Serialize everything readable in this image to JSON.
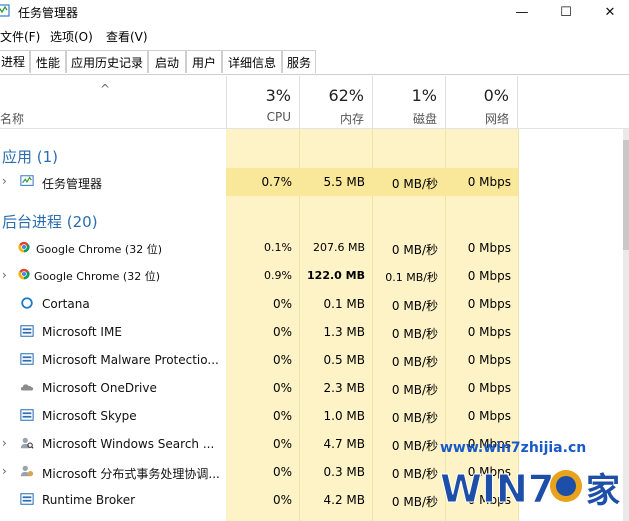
{
  "window": {
    "title": "任务管理器",
    "controls": {
      "minimize": "—",
      "maximize": "☐",
      "close": "✕"
    }
  },
  "menu": [
    "文件(F)",
    "选项(O)",
    "查看(V)"
  ],
  "tabs": [
    "进程",
    "性能",
    "应用历史记录",
    "启动",
    "用户",
    "详细信息",
    "服务"
  ],
  "header": {
    "name_label": "名称",
    "columns": [
      {
        "pct": "3%",
        "label": "CPU"
      },
      {
        "pct": "62%",
        "label": "内存"
      },
      {
        "pct": "1%",
        "label": "磁盘"
      },
      {
        "pct": "0%",
        "label": "网络"
      }
    ]
  },
  "groups": {
    "apps": "应用 (1)",
    "background": "后台进程 (20)"
  },
  "rows": [
    {
      "name": "任务管理器",
      "icon": "task-manager-icon",
      "expand": "›",
      "cpu": "0.7%",
      "mem": "5.5 MB",
      "disk": "0 MB/秒",
      "net": "0 Mbps"
    },
    {
      "name": "Google Chrome (32 位)",
      "icon": "chrome-icon",
      "expand": "",
      "cpu": "0.1%",
      "mem": "207.6 MB",
      "disk": "0 MB/秒",
      "net": "0 Mbps"
    },
    {
      "name": "Google Chrome (32 位)",
      "icon": "chrome-icon",
      "expand": "›",
      "cpu": "0.9%",
      "mem": "122.0 MB",
      "disk": "0.1 MB/秒",
      "net": "0 Mbps"
    },
    {
      "name": "Cortana",
      "icon": "cortana-icon",
      "expand": "",
      "cpu": "0%",
      "mem": "0.1 MB",
      "disk": "0 MB/秒",
      "net": "0 Mbps"
    },
    {
      "name": "Microsoft IME",
      "icon": "ime-icon",
      "expand": "",
      "cpu": "0%",
      "mem": "1.3 MB",
      "disk": "0 MB/秒",
      "net": "0 Mbps"
    },
    {
      "name": "Microsoft Malware Protectio...",
      "icon": "malware-icon",
      "expand": "",
      "cpu": "0%",
      "mem": "0.5 MB",
      "disk": "0 MB/秒",
      "net": "0 Mbps"
    },
    {
      "name": "Microsoft OneDrive",
      "icon": "onedrive-icon",
      "expand": "",
      "cpu": "0%",
      "mem": "2.3 MB",
      "disk": "0 MB/秒",
      "net": "0 Mbps"
    },
    {
      "name": "Microsoft Skype",
      "icon": "skype-icon",
      "expand": "",
      "cpu": "0%",
      "mem": "1.0 MB",
      "disk": "0 MB/秒",
      "net": "0 Mbps"
    },
    {
      "name": "Microsoft Windows Search ...",
      "icon": "search-person-icon",
      "expand": "›",
      "cpu": "0%",
      "mem": "4.7 MB",
      "disk": "0 MB/秒",
      "net": "0 Mbps"
    },
    {
      "name": "Microsoft 分布式事务处理协调...",
      "icon": "dtc-icon",
      "expand": "›",
      "cpu": "0%",
      "mem": "0.3 MB",
      "disk": "0 MB/秒",
      "net": "0 Mbps"
    },
    {
      "name": "Runtime Broker",
      "icon": "broker-icon",
      "expand": "",
      "cpu": "0%",
      "mem": "4.2 MB",
      "disk": "0 MB/秒",
      "net": "0 Mbps"
    }
  ],
  "watermark": {
    "url": "www.win7zhijia.cn",
    "logo_text": "WIN7",
    "logo_suffix": "家"
  },
  "colors": {
    "highlight": "#f9e79a",
    "column_bg": "#fdf3c7",
    "group_title": "#2a6db0"
  }
}
